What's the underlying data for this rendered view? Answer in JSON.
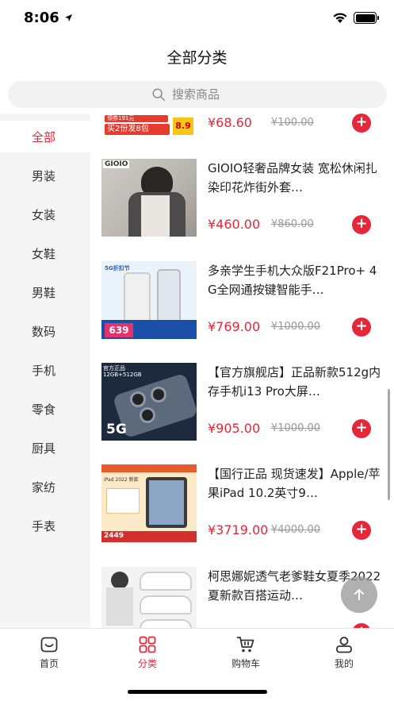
{
  "status_bar": {
    "time": "8:06"
  },
  "header": {
    "title": "全部分类"
  },
  "search": {
    "placeholder": "搜索商品"
  },
  "sidebar": {
    "items": [
      {
        "label": "全部",
        "active": true
      },
      {
        "label": "男装"
      },
      {
        "label": "女装"
      },
      {
        "label": "女鞋"
      },
      {
        "label": "男鞋"
      },
      {
        "label": "数码"
      },
      {
        "label": "手机"
      },
      {
        "label": "零食"
      },
      {
        "label": "厨具"
      },
      {
        "label": "家纺"
      },
      {
        "label": "手表"
      }
    ]
  },
  "products": [
    {
      "title": "",
      "price": "¥68.60",
      "old_price": "¥100.00",
      "banner": {
        "line1": "领券191元",
        "line2": "买2份发8包",
        "badge": "8.9"
      }
    },
    {
      "title": "GIOIO轻奢品牌女装 宽松休闲扎染印花炸街外套…",
      "price": "¥460.00",
      "old_price": "¥860.00",
      "image_text": "GIOIO"
    },
    {
      "title": "多亲学生手机大众版F21Pro+ 4G全网通按键智能手…",
      "price": "¥769.00",
      "old_price": "¥1000.00",
      "image_text": {
        "tag": "5G折扣节",
        "price": "639"
      }
    },
    {
      "title": "【官方旗舰店】正品新款512g内存手机i13 Pro大屏…",
      "price": "¥905.00",
      "old_price": "¥1000.00",
      "image_text": {
        "line1": "官方正品",
        "line2": "12GB+512GB",
        "tag": "5G"
      }
    },
    {
      "title": "【国行正品 现货速发】Apple/苹果iPad 10.2英寸9…",
      "price": "¥3719.00",
      "old_price": "¥4000.00",
      "image_text": {
        "line1": "iPad 2022 新款",
        "price": "2449"
      }
    },
    {
      "title": "柯思娜妮透气老爹鞋女夏季2022夏新款百搭运动…",
      "price": "",
      "old_price": ""
    }
  ],
  "add_icon": "plus-icon",
  "tabbar": {
    "items": [
      {
        "label": "首页",
        "icon": "home-icon"
      },
      {
        "label": "分类",
        "icon": "grid-icon",
        "active": true
      },
      {
        "label": "购物车",
        "icon": "cart-icon"
      },
      {
        "label": "我的",
        "icon": "user-icon"
      }
    ]
  },
  "colors": {
    "accent": "#e62739",
    "sidebar_bg": "#f5f5f5",
    "search_bg": "#f2f2f2"
  }
}
